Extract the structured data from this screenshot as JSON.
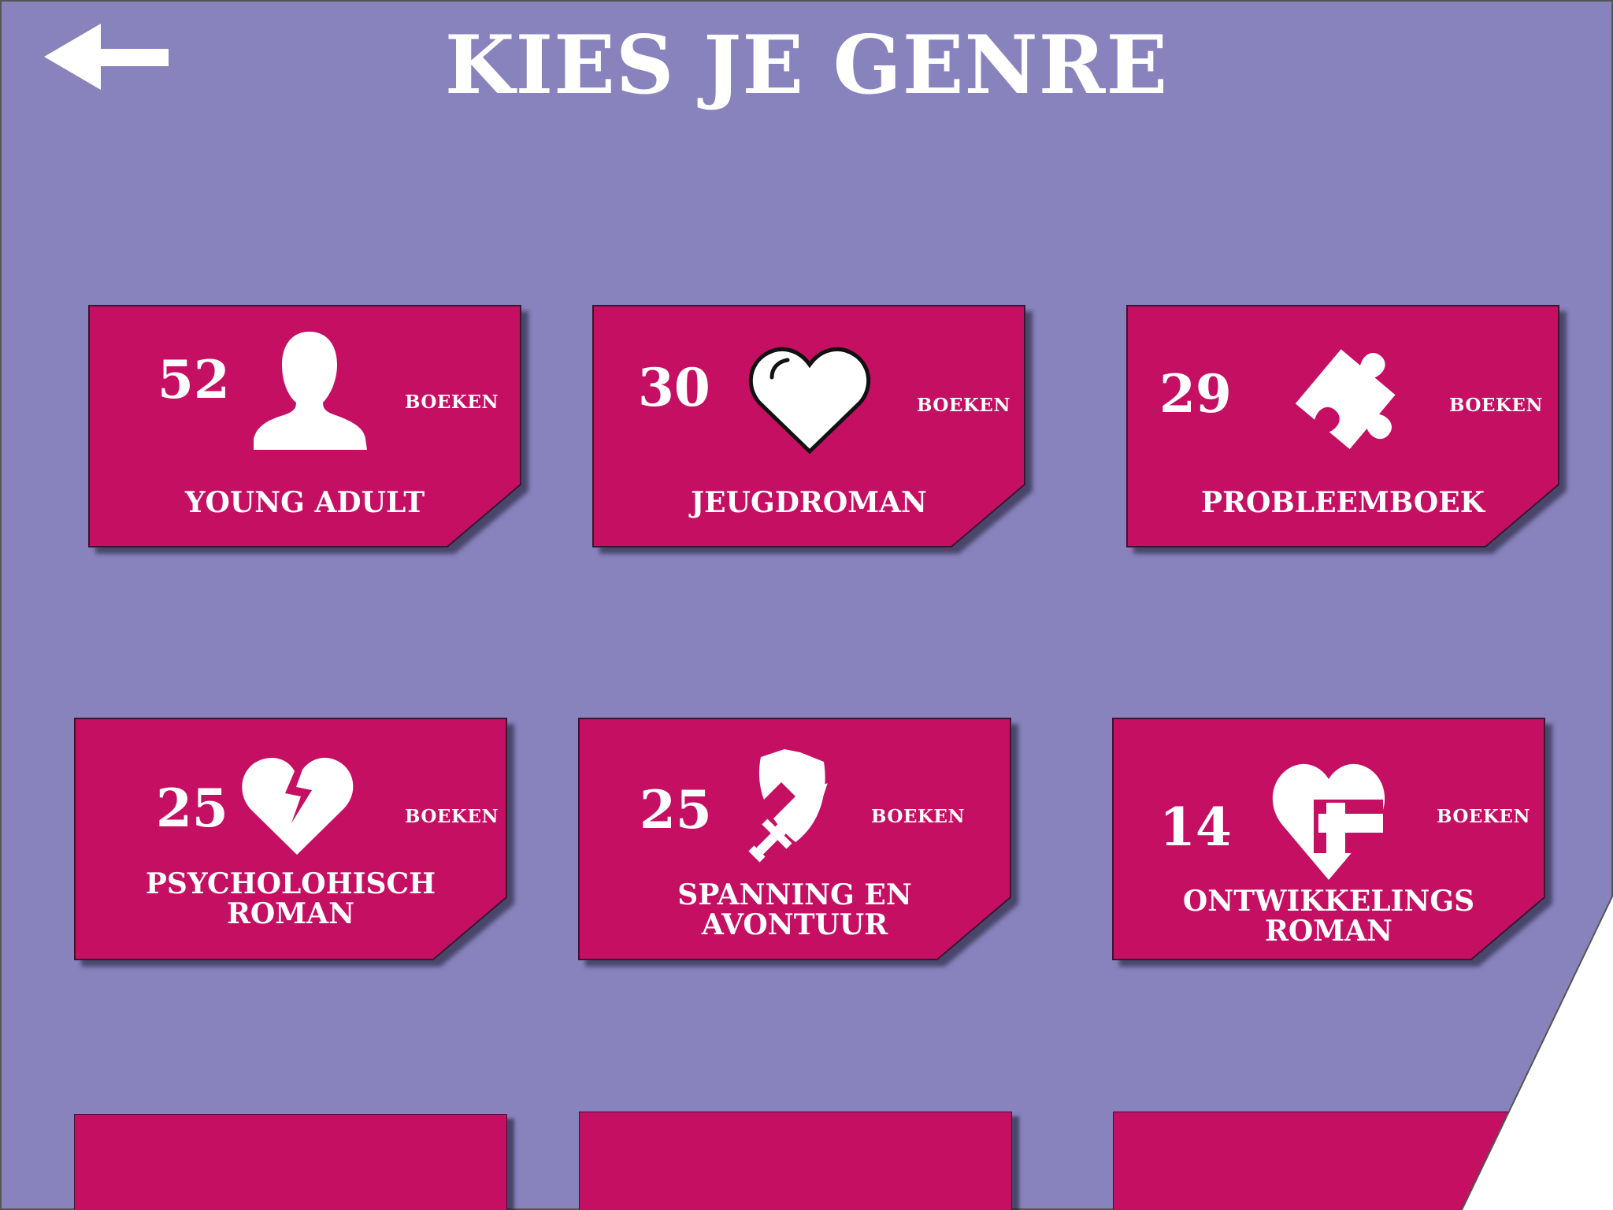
{
  "header": {
    "title": "KIES JE GENRE",
    "back_icon": "arrow-left-icon"
  },
  "colors": {
    "background": "#8883bd",
    "card": "#c40f62",
    "text": "#ffffff"
  },
  "genres": [
    {
      "count": "52",
      "unit": "BOEKEN",
      "name_lines": [
        "YOUNG ADULT"
      ],
      "icon": "person-silhouette-icon"
    },
    {
      "count": "30",
      "unit": "BOEKEN",
      "name_lines": [
        "JEUGDROMAN"
      ],
      "icon": "heart-icon"
    },
    {
      "count": "29",
      "unit": "BOEKEN",
      "name_lines": [
        "PROBLEEMBOEK"
      ],
      "icon": "puzzle-piece-icon"
    },
    {
      "count": "25",
      "unit": "BOEKEN",
      "name_lines": [
        "PSYCHOLOHISCH",
        "ROMAN"
      ],
      "icon": "broken-heart-icon"
    },
    {
      "count": "25",
      "unit": "BOEKEN",
      "name_lines": [
        "SPANNING EN",
        "AVONTUUR"
      ],
      "icon": "sword-shield-icon"
    },
    {
      "count": "14",
      "unit": "BOEKEN",
      "name_lines": [
        "ONTWIKKELINGS",
        "ROMAN"
      ],
      "icon": "heart-plus-icon"
    }
  ]
}
